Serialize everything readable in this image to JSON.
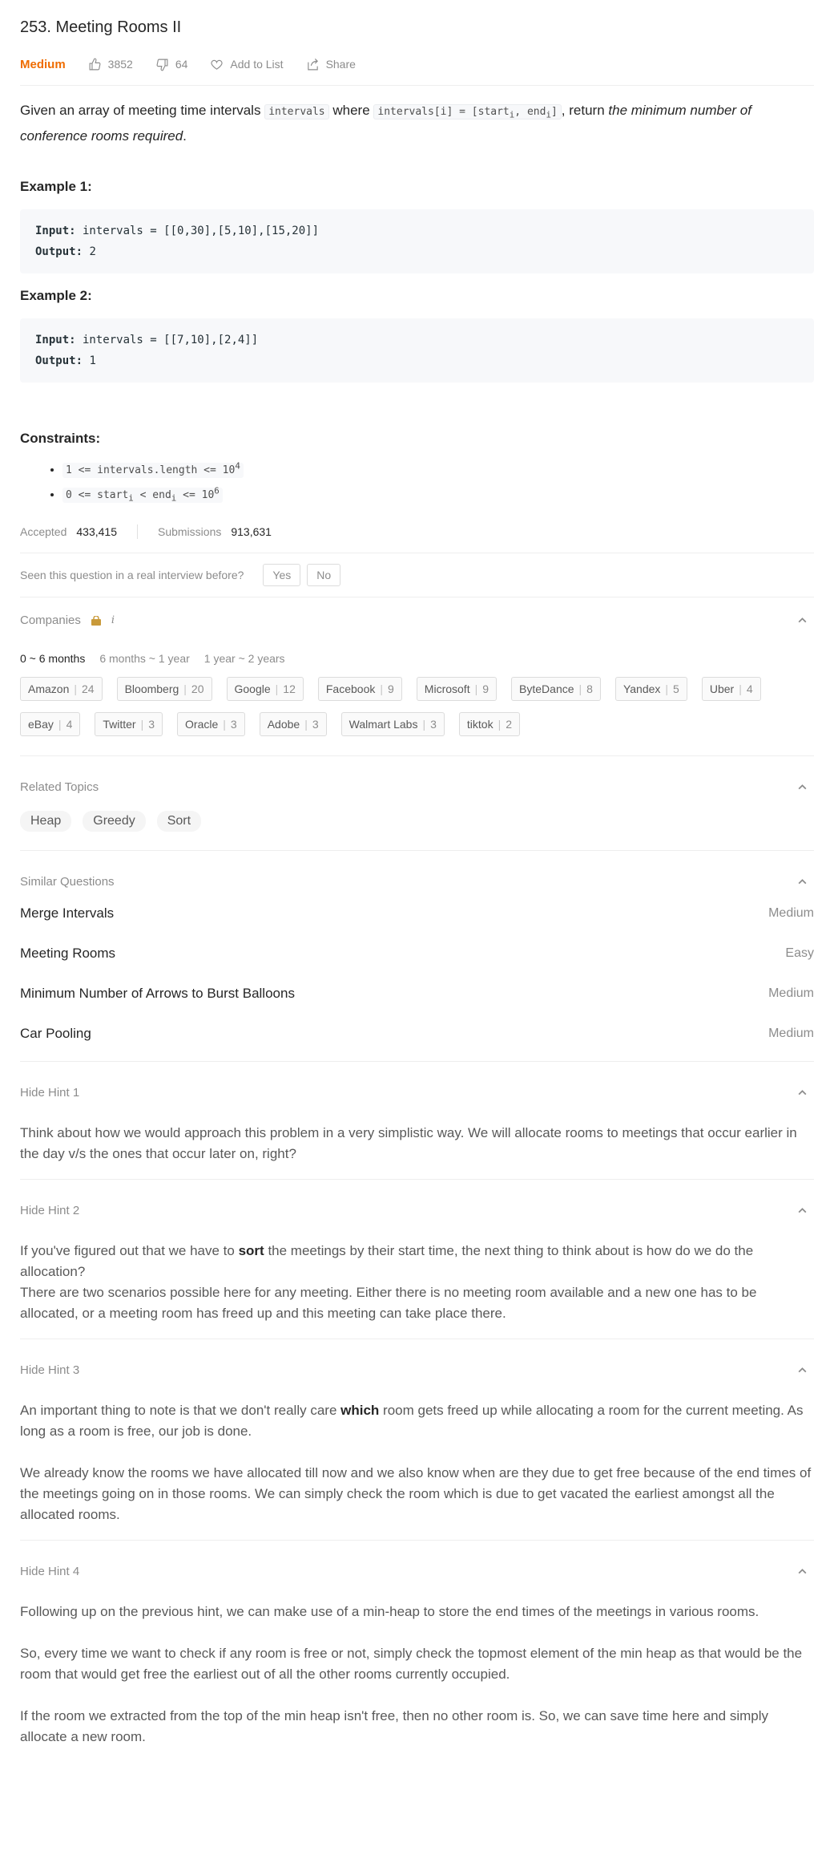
{
  "problem": {
    "title": "253. Meeting Rooms II",
    "difficulty": "Medium",
    "likes": "3852",
    "dislikes": "64",
    "add_to_list": "Add to List",
    "share": "Share"
  },
  "description": {
    "t1": "Given an array of meeting time intervals ",
    "c1": "intervals",
    "t2": " where ",
    "c2_a": "intervals[i] = [start",
    "c2_sub1": "i",
    "c2_b": ", end",
    "c2_sub2": "i",
    "c2_c": "]",
    "t3": ", return ",
    "t4_em": "the minimum number of conference rooms required",
    "t5": "."
  },
  "examples": [
    {
      "title": "Example 1:",
      "input_label": "Input:",
      "input": " intervals = [[0,30],[5,10],[15,20]]",
      "output_label": "Output:",
      "output": " 2"
    },
    {
      "title": "Example 2:",
      "input_label": "Input:",
      "input": " intervals = [[7,10],[2,4]]",
      "output_label": "Output:",
      "output": " 1"
    }
  ],
  "constraints": {
    "title": "Constraints:",
    "c1_a": "1 <= intervals.length <= 10",
    "c1_sup": "4",
    "c2_a": "0 <= start",
    "c2_sub1": "i",
    "c2_b": " < end",
    "c2_sub2": "i",
    "c2_c": " <= 10",
    "c2_sup": "6"
  },
  "stats": {
    "accepted_label": "Accepted",
    "accepted": "433,415",
    "submissions_label": "Submissions",
    "submissions": "913,631"
  },
  "seen": {
    "question": "Seen this question in a real interview before?",
    "yes": "Yes",
    "no": "No"
  },
  "companies": {
    "label": "Companies",
    "info": "i",
    "tabs": [
      "0 ~ 6 months",
      "6 months ~ 1 year",
      "1 year ~ 2 years"
    ],
    "items": [
      {
        "name": "Amazon",
        "count": "24"
      },
      {
        "name": "Bloomberg",
        "count": "20"
      },
      {
        "name": "Google",
        "count": "12"
      },
      {
        "name": "Facebook",
        "count": "9"
      },
      {
        "name": "Microsoft",
        "count": "9"
      },
      {
        "name": "ByteDance",
        "count": "8"
      },
      {
        "name": "Yandex",
        "count": "5"
      },
      {
        "name": "Uber",
        "count": "4"
      },
      {
        "name": "eBay",
        "count": "4"
      },
      {
        "name": "Twitter",
        "count": "3"
      },
      {
        "name": "Oracle",
        "count": "3"
      },
      {
        "name": "Adobe",
        "count": "3"
      },
      {
        "name": "Walmart Labs",
        "count": "3"
      },
      {
        "name": "tiktok",
        "count": "2"
      }
    ]
  },
  "related_topics": {
    "label": "Related Topics",
    "items": [
      "Heap",
      "Greedy",
      "Sort"
    ]
  },
  "similar_questions": {
    "label": "Similar Questions",
    "items": [
      {
        "title": "Merge Intervals",
        "difficulty": "Medium"
      },
      {
        "title": "Meeting Rooms",
        "difficulty": "Easy"
      },
      {
        "title": "Minimum Number of Arrows to Burst Balloons",
        "difficulty": "Medium"
      },
      {
        "title": "Car Pooling",
        "difficulty": "Medium"
      }
    ]
  },
  "hints": [
    {
      "label": "Hide Hint 1",
      "p1": "Think about how we would approach this problem in a very simplistic way. We will allocate rooms to meetings that occur earlier in the day v/s the ones that occur later on, right?"
    },
    {
      "label": "Hide Hint 2",
      "p1_a": "If you've figured out that we have to ",
      "p1_b": "sort",
      "p1_c": " the meetings by their start time, the next thing to think about is how do we do the allocation?",
      "p2": "There are two scenarios possible here for any meeting. Either there is no meeting room available and a new one has to be allocated, or a meeting room has freed up and this meeting can take place there."
    },
    {
      "label": "Hide Hint 3",
      "p1_a": "An important thing to note is that we don't really care ",
      "p1_b": "which",
      "p1_c": " room gets freed up while allocating a room for the current meeting. As long as a room is free, our job is done.",
      "p2": "We already know the rooms we have allocated till now and we also know when are they due to get free because of the end times of the meetings going on in those rooms. We can simply check the room which is due to get vacated the earliest amongst all the allocated rooms."
    },
    {
      "label": "Hide Hint 4",
      "p1": "Following up on the previous hint, we can make use of a min-heap to store the end times of the meetings in various rooms.",
      "p2": "So, every time we want to check if any room is free or not, simply check the topmost element of the min heap as that would be the room that would get free the earliest out of all the other rooms currently occupied.",
      "p3": "If the room we extracted from the top of the min heap isn't free, then no other room is. So, we can save time here and simply allocate a new room."
    }
  ]
}
